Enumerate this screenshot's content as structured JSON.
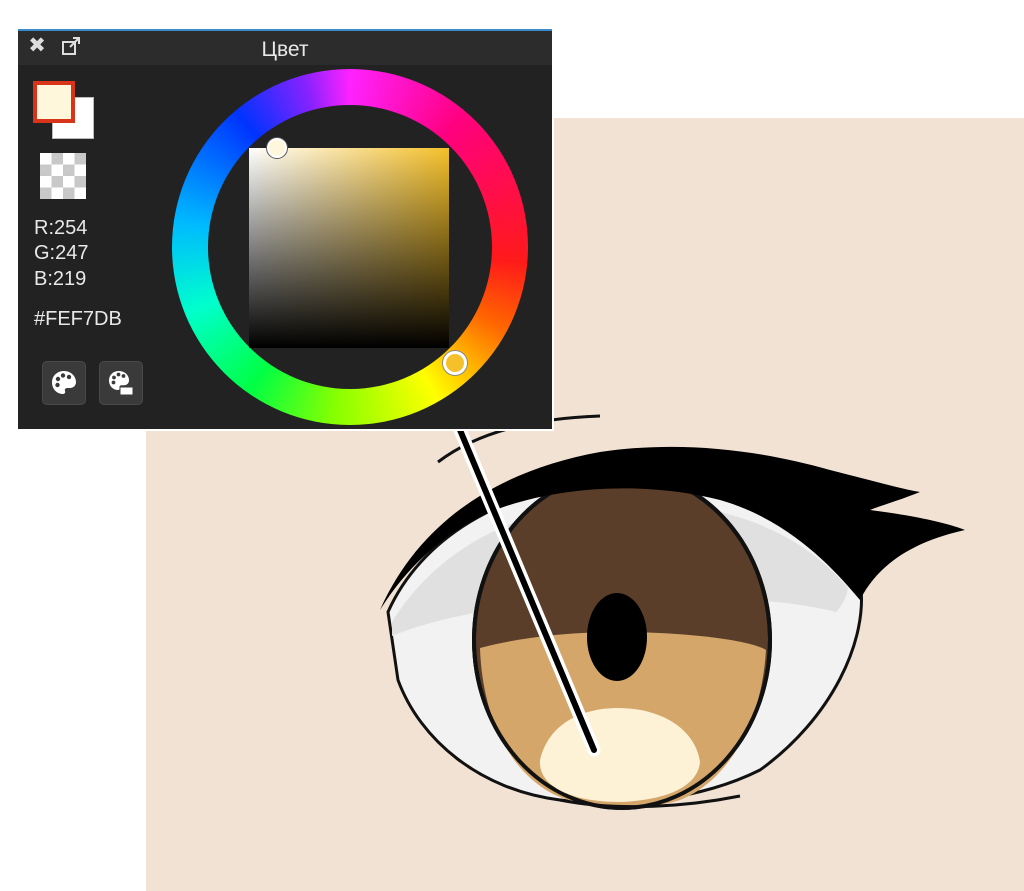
{
  "panel": {
    "title": "Цвет",
    "close_icon": "close-icon",
    "popout_icon": "popout-icon"
  },
  "color": {
    "foreground_hex": "#FEF7DB",
    "background_hex": "#FFFFFF",
    "r_text": "R:254",
    "g_text": "G:247",
    "b_text": "B:219",
    "hex_text": "#FEF7DB",
    "hue_color": "#F5C02A"
  },
  "tools": {
    "palette_icon": "palette-icon",
    "palette_set_icon": "palette-set-icon"
  },
  "canvas": {
    "background_color": "#F1E2D4",
    "iris_dark": "#5A3E2A",
    "iris_light": "#D4A66A",
    "highlight": "#FDF2D6",
    "sclera_shadow": "#E0E0E0",
    "sclera": "#F2F2F2"
  }
}
